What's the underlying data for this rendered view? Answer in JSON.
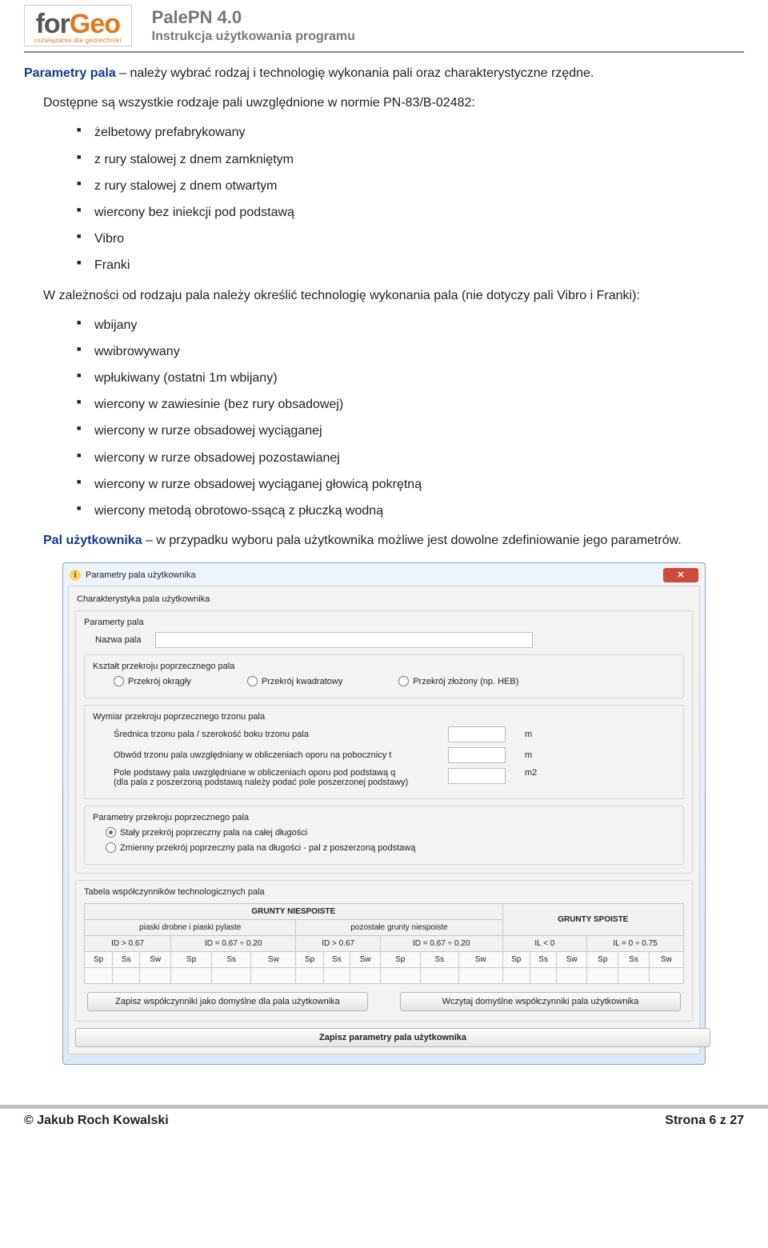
{
  "header": {
    "logo_for": "for",
    "logo_geo": "Geo",
    "logo_sub": "rozwiązania dla geotechniki",
    "title": "PalePN 4.0",
    "subtitle": "Instrukcja użytkowania programu"
  },
  "p1": {
    "lead": "Parametry pala",
    "rest": " – należy wybrać rodzaj i technologię wykonania pali oraz charakterystyczne rzędne."
  },
  "p2": "Dostępne są wszystkie rodzaje pali uwzględnione w normie PN-83/B-02482:",
  "list1": [
    "żelbetowy prefabrykowany",
    "z rury stalowej z dnem zamkniętym",
    "z rury stalowej z dnem otwartym",
    "wiercony bez iniekcji pod podstawą",
    "Vibro",
    "Franki"
  ],
  "p3": "W zależności od rodzaju pala należy określić technologię wykonania pala (nie dotyczy pali Vibro i Franki):",
  "list2": [
    "wbijany",
    "wwibrowywany",
    "wpłukiwany (ostatni 1m wbijany)",
    "wiercony w zawiesinie (bez rury obsadowej)",
    "wiercony w rurze obsadowej wyciąganej",
    "wiercony w rurze obsadowej pozostawianej",
    "wiercony w rurze obsadowej wyciąganej głowicą pokrętną",
    "wiercony metodą obrotowo-ssącą z płuczką wodną"
  ],
  "p4": {
    "lead": "Pal użytkownika",
    "rest": " – w przypadku wyboru pala użytkownika możliwe jest dowolne zdefiniowanie jego parametrów."
  },
  "dialog": {
    "title": "Parametry pala użytkownika",
    "sec1": "Charakterystyka pala użytkownika",
    "sec_param": "Paramerty pala",
    "name_label": "Nazwa pala",
    "shape_title": "Kształt przekroju poprzecznego pala",
    "shape_opts": [
      "Przekrój okrągły",
      "Przekrój kwadratowy",
      "Przekrój złożony (np. HEB)"
    ],
    "dim_title": "Wymiar przekroju poprzecznego trzonu pala",
    "dim1": "Średnica trzonu pala / szerokość boku trzonu pala",
    "dim1_u": "m",
    "dim2": "Obwód trzonu pala uwzględniany w obliczeniach oporu na pobocznicy t",
    "dim2_u": "m",
    "dim3a": "Pole podstawy pala uwzględniane w obliczeniach oporu pod podstawą q",
    "dim3b": "(dla pala z poszerzoną podstawą należy podać pole poszerzonej podstawy)",
    "dim3_u": "m2",
    "sect_title": "Parametry przekroju poprzecznego pala",
    "sect_opts": [
      "Stały przekrój poprzeczny pala na całej długości",
      "Zmienny przekrój poprzeczny pala na długości - pal z poszerzoną podstawą"
    ],
    "coef_title": "Tabela współczynników technologicznych pala",
    "grp_niesp": "GRUNTY NIESPOISTE",
    "grp_sp": "GRUNTY SPOISTE",
    "sub1": "piaski drobne i piaski pylaste",
    "sub2": "pozostałe grunty niespoiste",
    "id1": "ID > 0.67",
    "id2": "ID = 0.67 ÷ 0.20",
    "il1": "IL < 0",
    "il2": "IL = 0 ÷ 0.75",
    "cols": [
      "Sp",
      "Ss",
      "Sw"
    ],
    "btn1": "Zapisz współczynniki jako domyślne dla pala użytkownika",
    "btn2": "Wczytaj domyślne współczynniki pala użytkownika",
    "btn3": "Zapisz parametry pala użytkownika"
  },
  "footer": {
    "left": "© Jakub Roch Kowalski",
    "right": "Strona 6 z 27"
  }
}
